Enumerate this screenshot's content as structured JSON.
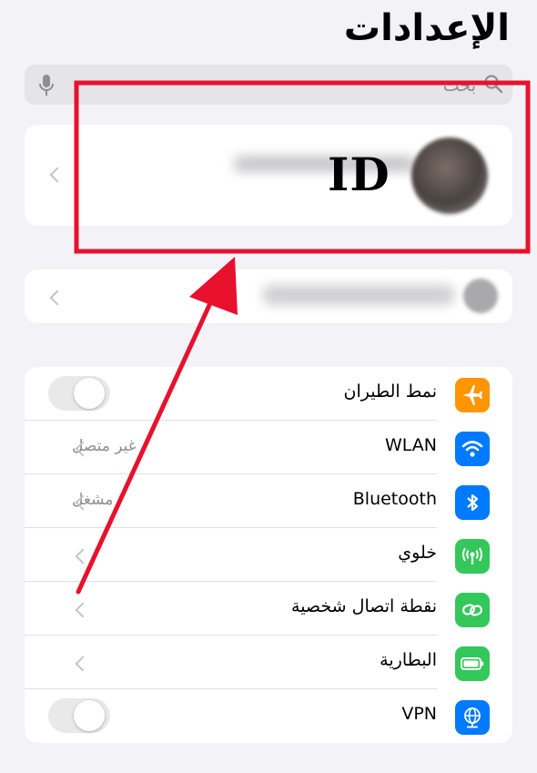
{
  "header": {
    "title": "الإعدادات"
  },
  "search": {
    "placeholder": "بحث"
  },
  "account": {
    "badge_text": "ID"
  },
  "settings": [
    {
      "label": "نمط الطيران",
      "value": "",
      "icon": "airplane-icon",
      "color": "#ff9500",
      "control": "toggle"
    },
    {
      "label": "WLAN",
      "value": "غير متصل",
      "icon": "wifi-icon",
      "color": "#007aff",
      "control": "chevron"
    },
    {
      "label": "Bluetooth",
      "value": "مشغل",
      "icon": "bluetooth-icon",
      "color": "#007aff",
      "control": "chevron"
    },
    {
      "label": "خلوي",
      "value": "",
      "icon": "cellular-antenna-icon",
      "color": "#34c759",
      "control": "chevron"
    },
    {
      "label": "نقطة اتصال شخصية",
      "value": "",
      "icon": "link-chain-icon",
      "color": "#34c759",
      "control": "chevron"
    },
    {
      "label": "البطارية",
      "value": "",
      "icon": "battery-icon",
      "color": "#34c759",
      "control": "chevron"
    },
    {
      "label": "VPN",
      "value": "",
      "icon": "globe-network-icon",
      "color": "#007aff",
      "control": "toggle"
    }
  ],
  "annotation": {
    "color": "#e8112d"
  }
}
